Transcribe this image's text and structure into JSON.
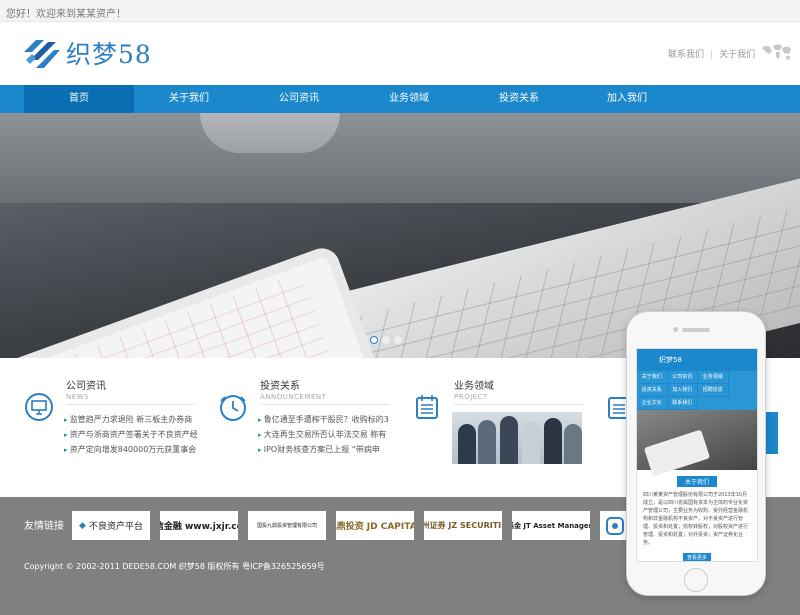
{
  "topbar": {
    "greeting": "您好！欢迎来到某某资产！"
  },
  "header": {
    "logo_text": "织梦58",
    "links": [
      "联系我们",
      "关于我们"
    ],
    "separator": "|"
  },
  "nav": {
    "items": [
      "首页",
      "关于我们",
      "公司资讯",
      "业务领域",
      "投资关系",
      "加入我们"
    ],
    "active": "首页"
  },
  "modules": {
    "news": {
      "title": "公司资讯",
      "subtitle": "NEWS",
      "items": [
        "监管趋严力求退险 新三板主办券商",
        "资产与浙商资产签署关于不良资产经",
        "资产定向增发840000万元获董事会"
      ]
    },
    "announcement": {
      "title": "投资关系",
      "subtitle": "ANNOUNCEMENT",
      "items": [
        "鲁亿通至手遭榨干股民？收购标的3",
        "大连再生交易所否认非法交易 称有",
        "IPO财务核查方案已上报 “带病申"
      ]
    },
    "project": {
      "title": "业务领域",
      "subtitle": "PROJECT"
    }
  },
  "links": {
    "label": "友情链接",
    "items": [
      {
        "name": "不良资产平台",
        "style": "light"
      },
      {
        "name": "九信金融 www.jxjr.com",
        "style": "light"
      },
      {
        "name": "国投九鼎投资管理有限公司",
        "style": "light"
      },
      {
        "name": "九鼎投资 JD CAPITAL",
        "style": "light"
      },
      {
        "name": "九州证券 JZ SECURITIES",
        "style": "dark"
      },
      {
        "name": "九泰基金 JT Asset Management",
        "style": "light"
      },
      {
        "name": "",
        "style": "light"
      }
    ]
  },
  "footer": {
    "copyright": "Copyright © 2002-2011 DEDE58.COM 织梦58 版权所有 粤ICP备326525659号"
  },
  "phone": {
    "logo": "织梦58",
    "nav": [
      "关于我们",
      "公司资讯",
      "业务领域",
      "投资关系",
      "加入我们",
      "招聘信息",
      "企业文化",
      "联系我们"
    ],
    "section_title": "关于我们",
    "about_text": "四川某某资产管理股份有限公司于2013年10月成立，是以四川省属国有资本为主体的专业化资产管理公司，主要业务为收购、受托经营金融机构和非金融机构不良资产，对不良资产进行管理、投资和处置；债权转股权，对股权资产进行管理、投资和处置；对外投资；资产证券化业务。",
    "more": "查看更多"
  },
  "colors": {
    "primary": "#1b88cc",
    "nav_active": "#0a6fb2",
    "footer_bg": "#808080"
  }
}
